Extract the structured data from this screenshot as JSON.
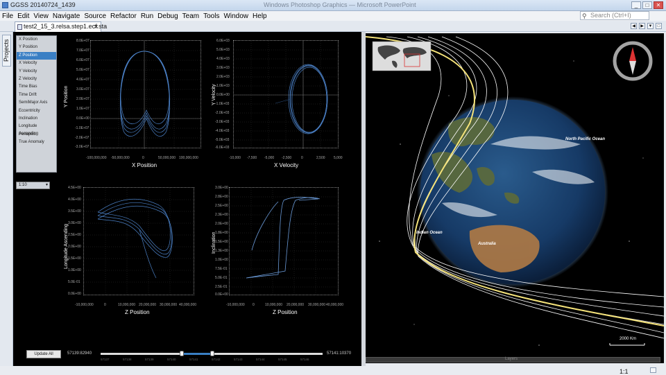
{
  "window": {
    "title": "GGSS 20140724_1439",
    "center_title": "Windows Photoshop Graphics — Microsoft PowerPoint",
    "min": "_",
    "max": "□",
    "close": "✕"
  },
  "menu": [
    "File",
    "Edit",
    "View",
    "Navigate",
    "Source",
    "Refactor",
    "Run",
    "Debug",
    "Team",
    "Tools",
    "Window",
    "Help"
  ],
  "search": {
    "placeholder": "Search (Ctrl+I)",
    "icon": "search-icon"
  },
  "editor_tab": {
    "label": "test2_15_3.relsa.step1.ecf.sta",
    "close": "✕"
  },
  "sidebar": {
    "projects_label": "Projects"
  },
  "variables": {
    "items": [
      "X Position",
      "Y Position",
      "Z Position",
      "X Velocity",
      "Y Velocity",
      "Z Velocity",
      "Time Bias",
      "Time Drift",
      "SemiMajor Axis",
      "Eccentricity",
      "Inclination",
      "Longitude Ascending",
      "Periapsis",
      "True Anomaly"
    ],
    "selected": "Z Position"
  },
  "rate_combo": {
    "value": "1:10"
  },
  "plots": [
    {
      "name": "y-pos-vs-x-pos",
      "ylabel": "Y Position",
      "xlabel": "X Position",
      "yticks": [
        "8.0E+07",
        "7.0E+07",
        "6.0E+07",
        "5.0E+07",
        "4.0E+07",
        "3.0E+07",
        "2.0E+07",
        "1.0E+07",
        "0.0E+00",
        "-1.0E+07",
        "-2.0E+07",
        "-3.0E+07"
      ],
      "xticks": [
        "-100,000,000",
        "-50,000,000",
        "0",
        "50,000,000",
        "100,000,000"
      ]
    },
    {
      "name": "y-vel-vs-x-vel",
      "ylabel": "Y Velocity",
      "xlabel": "X Velocity",
      "yticks": [
        "6.0E+03",
        "5.0E+03",
        "4.0E+03",
        "3.0E+03",
        "2.0E+03",
        "1.0E+03",
        "0.0E+00",
        "-1.0E+03",
        "-2.0E+03",
        "-3.0E+03",
        "-4.0E+03",
        "-5.0E+03",
        "-6.0E+03"
      ],
      "xticks": [
        "-10,000",
        "-7,500",
        "-5,000",
        "-2,500",
        "0",
        "2,500",
        "5,000"
      ]
    },
    {
      "name": "long-asc-vs-z-pos",
      "ylabel": "Longitude Ascending",
      "xlabel": "Z Position",
      "yticks": [
        "4.5E+00",
        "4.0E+00",
        "3.5E+00",
        "3.0E+00",
        "2.5E+00",
        "2.0E+00",
        "1.5E+00",
        "1.0E+00",
        "5.0E-01",
        "0.0E+00"
      ],
      "xticks": [
        "-10,000,000",
        "0",
        "10,000,000",
        "20,000,000",
        "30,000,000",
        "40,000,000"
      ]
    },
    {
      "name": "inclination-vs-z-pos",
      "ylabel": "Inclination",
      "xlabel": "Z Position",
      "yticks": [
        "3.0E+00",
        "2.8E+00",
        "2.5E+00",
        "2.3E+00",
        "2.0E+00",
        "1.8E+00",
        "1.5E+00",
        "1.3E+00",
        "1.0E+00",
        "7.5E-01",
        "5.0E-01",
        "2.5E-01",
        "0.0E+00"
      ],
      "xticks": [
        "-10,000,000",
        "0",
        "10,000,000",
        "20,000,000",
        "30,000,000",
        "40,000,000"
      ]
    }
  ],
  "timeline": {
    "update_button": "Update All",
    "start": "57139:82940",
    "end": "57141:10370",
    "ticks": [
      "57137",
      "57138",
      "57139",
      "57140",
      "57141",
      "57142",
      "57143",
      "57144",
      "57145",
      "57146"
    ],
    "selection": [
      0.37,
      0.5
    ]
  },
  "globe": {
    "labels": {
      "north_pacific": "North Pacific Ocean",
      "indian": "Indian Ocean",
      "australia": "Australia"
    },
    "scale": "2000 Km",
    "scroll_label": "Layers"
  },
  "status": {
    "zoom": "1:1"
  }
}
